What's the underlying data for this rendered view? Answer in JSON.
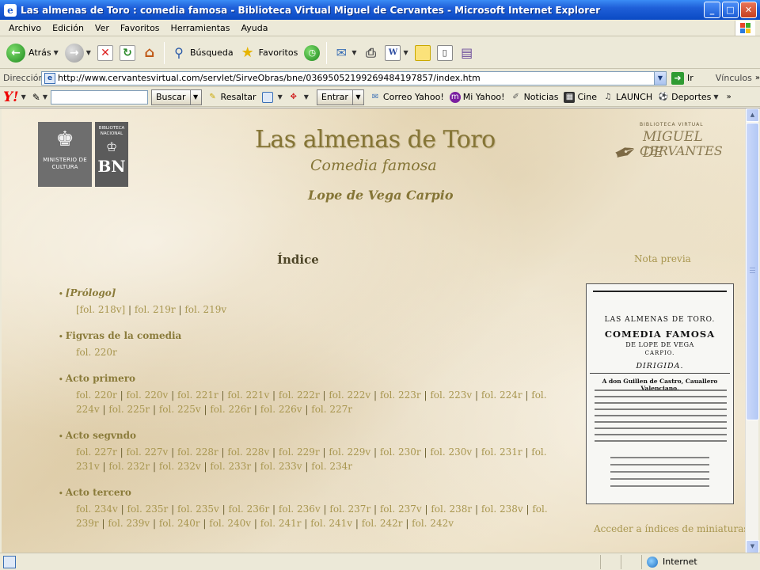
{
  "window": {
    "title": "Las almenas de Toro : comedia famosa - Biblioteca Virtual Miguel de Cervantes - Microsoft Internet Explorer",
    "minimize": "_",
    "maximize": "□",
    "close": "✕"
  },
  "menu": [
    "Archivo",
    "Edición",
    "Ver",
    "Favoritos",
    "Herramientas",
    "Ayuda"
  ],
  "toolbar": {
    "back_label": "Atrás",
    "search_label": "Búsqueda",
    "favorites_label": "Favoritos"
  },
  "address": {
    "label": "Dirección",
    "url": "http://www.cervantesvirtual.com/servlet/SirveObras/bne/03695052199269484197857/index.htm",
    "go_label": "Ir",
    "links_label": "Vínculos"
  },
  "yahoo": {
    "search_button": "Buscar",
    "highlight_label": "Resaltar",
    "enter_button": "Entrar",
    "items": [
      "Correo Yahoo!",
      "Mi Yahoo!",
      "Noticias",
      "Cine",
      "LAUNCH",
      "Deportes"
    ]
  },
  "logos": {
    "ministerio": "MINISTERIO DE CULTURA",
    "bn_top": "BIBLIOTECA NACIONAL",
    "bn": "BN",
    "bv_top": "BIBLIOTECA VIRTUAL",
    "bv_name1": "MIGUEL DE",
    "bv_name2": "CERVANTES"
  },
  "header": {
    "title": "Las almenas de Toro",
    "subtitle": "Comedia famosa",
    "author": "Lope de Vega Carpio"
  },
  "index": {
    "title": "Índice",
    "sections": [
      {
        "title": "[Prólogo]",
        "folios": [
          "[fol. 218v]",
          "fol. 219r",
          "fol. 219v"
        ]
      },
      {
        "title": "Figvras de la comedia",
        "folios": [
          "fol. 220r"
        ]
      },
      {
        "title": "Acto primero",
        "folios": [
          "fol. 220r",
          "fol. 220v",
          "fol. 221r",
          "fol. 221v",
          "fol. 222r",
          "fol. 222v",
          "fol. 223r",
          "fol. 223v",
          "fol. 224r",
          "fol. 224v",
          "fol. 225r",
          "fol. 225v",
          "fol. 226r",
          "fol. 226v",
          "fol. 227r"
        ]
      },
      {
        "title": "Acto segvndo",
        "folios": [
          "fol. 227r",
          "fol. 227v",
          "fol. 228r",
          "fol. 228v",
          "fol. 229r",
          "fol. 229v",
          "fol. 230r",
          "fol. 230v",
          "fol. 231r",
          "fol. 231v",
          "fol. 232r",
          "fol. 232v",
          "fol. 233r",
          "fol. 233v",
          "fol. 234r"
        ]
      },
      {
        "title": "Acto tercero",
        "folios": [
          "fol. 234v",
          "fol. 235r",
          "fol. 235v",
          "fol. 236r",
          "fol. 236v",
          "fol. 237r",
          "fol. 237v",
          "fol. 238r",
          "fol. 238v",
          "fol. 239r",
          "fol. 239v",
          "fol. 240r",
          "fol. 240v",
          "fol. 241r",
          "fol. 241v",
          "fol. 242r",
          "fol. 242v"
        ]
      }
    ]
  },
  "sidebar": {
    "nota_previa": "Nota previa",
    "facsimile": {
      "line1": "LAS ALMENAS DE TORO.",
      "line2": "COMEDIA FAMOSA",
      "line3": "DE LOPE DE VEGA",
      "line4": "CARPIO.",
      "line5": "DIRIGIDA.",
      "line6": "A don Guillen de Castro, Cauallero Valenciano."
    },
    "acceder": "Acceder a índices de miniaturas"
  },
  "status": {
    "zone": "Internet"
  },
  "colors": {
    "title_gold": "#857536",
    "link_gold": "#a8964f",
    "xp_blue": "#0a4ac4"
  }
}
